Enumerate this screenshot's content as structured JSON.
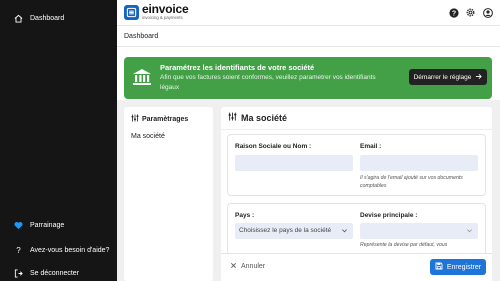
{
  "sidebar": {
    "items": [
      {
        "label": "Dashboard",
        "icon": "home-icon"
      },
      {
        "label": "Parrainage",
        "icon": "heart-icon"
      },
      {
        "label": "Avez-vous besoin d'aide?",
        "icon": "question-icon"
      },
      {
        "label": "Se déconnecter",
        "icon": "logout-icon"
      }
    ]
  },
  "header": {
    "logo_name": "einvoice",
    "logo_tagline": "invoicing & payments",
    "icons": [
      "help-icon",
      "settings-icon",
      "user-icon"
    ]
  },
  "breadcrumb": "Dashboard",
  "banner": {
    "title": "Paramétrez les identifiants de votre société",
    "description": "Afin que vos factures soient conformes, veuillez parametrer vos identifiants légaux",
    "button_label": "Démarrer le réglage"
  },
  "left_panel": {
    "title": "Paramètrages",
    "items": [
      "Ma société"
    ]
  },
  "main_panel": {
    "title": "Ma société",
    "company_name": {
      "label": "Raison Sociale ou Nom :",
      "value": ""
    },
    "email": {
      "label": "Email :",
      "value": "",
      "help": "Il s'agira de l'email ajouté sur vos documents comptables"
    },
    "country": {
      "label": "Pays :",
      "placeholder": "Choisissez le pays de la société"
    },
    "currency": {
      "label": "Devise principale :",
      "value": "",
      "help": "Représente la devise par défaut, vous"
    }
  },
  "footer": {
    "cancel_label": "Annuler",
    "save_label": "Enregistrer"
  },
  "colors": {
    "sidebar_bg": "#151515",
    "banner_bg": "#43a047",
    "primary": "#1e74d8",
    "input_bg": "#e8ecf6",
    "heart": "#2196f3"
  }
}
